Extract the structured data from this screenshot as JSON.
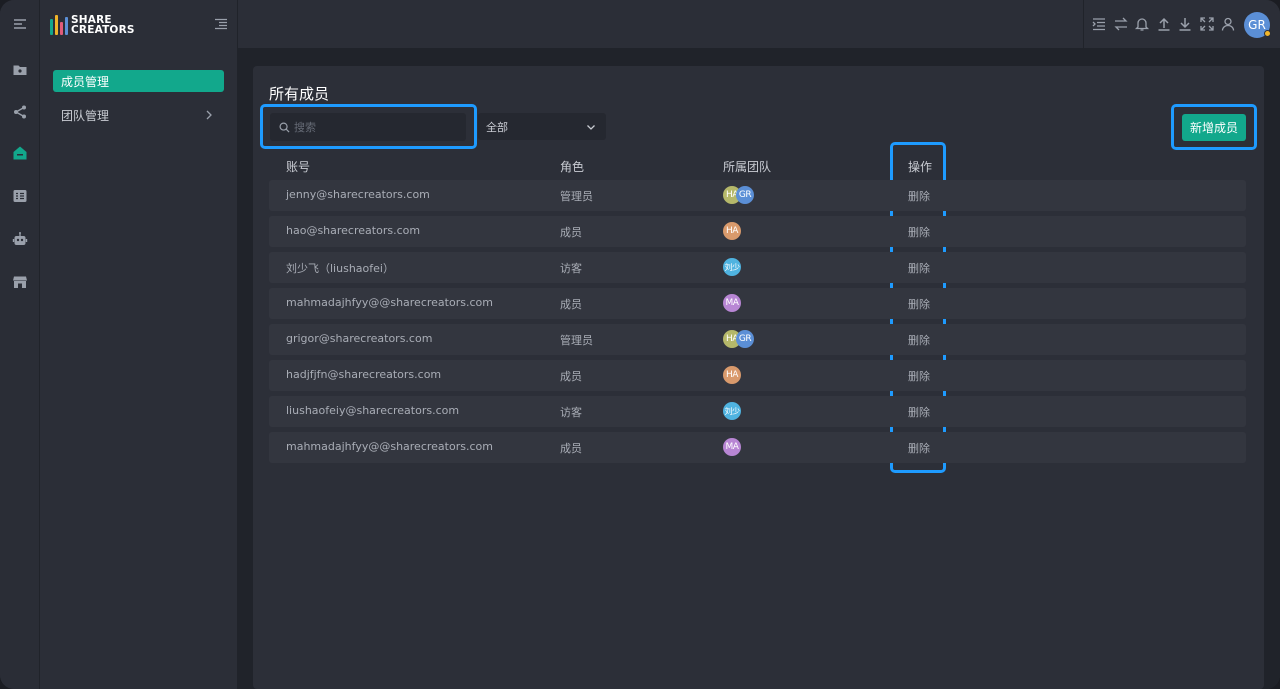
{
  "app": {
    "logo_line1": "SHARE",
    "logo_line2": "CREATORS",
    "brand_color": "#12a88c"
  },
  "rail": {
    "icons": [
      "menu-icon",
      "folder-icon",
      "share-icon",
      "home-icon",
      "list-icon",
      "robot-icon",
      "store-icon"
    ]
  },
  "sidebar": {
    "items": [
      {
        "label": "成员管理",
        "active": true
      },
      {
        "label": "团队管理",
        "active": false
      }
    ]
  },
  "header": {
    "icons": [
      "indent-icon",
      "swap-icon",
      "bell-icon",
      "upload-icon",
      "download-icon",
      "fullscreen-icon",
      "user-icon"
    ],
    "user_initials": "GR"
  },
  "main": {
    "title": "所有成员",
    "search_placeholder": "搜索",
    "filter_value": "全部",
    "add_button": "新增成员",
    "columns": [
      "账号",
      "角色",
      "所属团队",
      "操作"
    ],
    "rows": [
      {
        "account": "jenny@sharecreators.com",
        "role": "管理员",
        "teams": [
          {
            "label": "HA",
            "color": "#b5b86a"
          },
          {
            "label": "GR",
            "color": "#5b8fd6"
          }
        ],
        "action": "删除"
      },
      {
        "account": "hao@sharecreators.com",
        "role": "成员",
        "teams": [
          {
            "label": "HA",
            "color": "#d99a6c"
          }
        ],
        "action": "删除"
      },
      {
        "account": "刘少飞（liushaofei）",
        "role": "访客",
        "teams": [
          {
            "label": "刘少",
            "color": "#4fb3e0"
          }
        ],
        "action": "删除"
      },
      {
        "account": "mahmadajhfyy@@sharecreators.com",
        "role": "成员",
        "teams": [
          {
            "label": "MA",
            "color": "#b886d4"
          }
        ],
        "action": "删除"
      },
      {
        "account": "grigor@sharecreators.com",
        "role": "管理员",
        "teams": [
          {
            "label": "HA",
            "color": "#b5b86a"
          },
          {
            "label": "GR",
            "color": "#5b8fd6"
          }
        ],
        "action": "删除"
      },
      {
        "account": "hadjfjfn@sharecreators.com",
        "role": "成员",
        "teams": [
          {
            "label": "HA",
            "color": "#d99a6c"
          }
        ],
        "action": "删除"
      },
      {
        "account": "liushaofeiy@sharecreators.com",
        "role": "访客",
        "teams": [
          {
            "label": "刘少",
            "color": "#4fb3e0"
          }
        ],
        "action": "删除"
      },
      {
        "account": "mahmadajhfyy@@sharecreators.com",
        "role": "成员",
        "teams": [
          {
            "label": "MA",
            "color": "#b886d4"
          }
        ],
        "action": "删除"
      }
    ]
  }
}
